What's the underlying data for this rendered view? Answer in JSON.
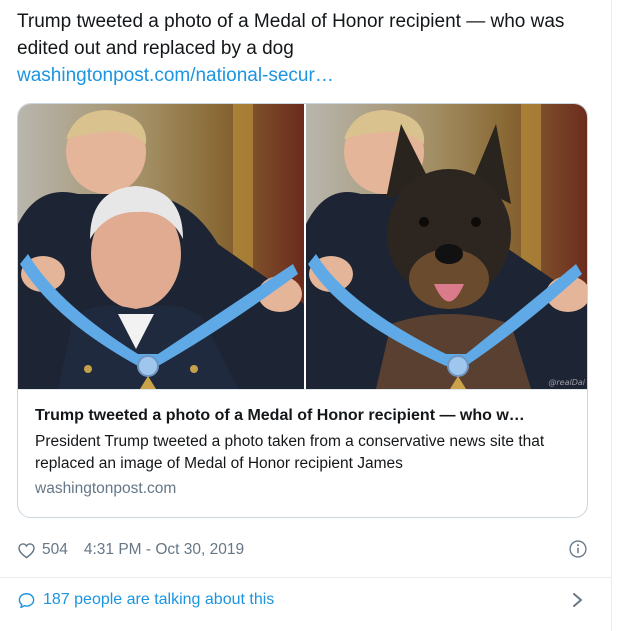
{
  "tweet": {
    "text": "Trump tweeted a photo of a Medal of Honor recipient — who was edited out and replaced by a dog",
    "link_text": "washingtonpost.com/national-secur…"
  },
  "card": {
    "title": "Trump tweeted a photo of a Medal of Honor recipient — who w…",
    "description": "President Trump tweeted a photo taken from a conservative news site that replaced an image of Medal of Honor recipient James",
    "domain": "washingtonpost.com",
    "watermark": "@realDai",
    "left_image": "medal-ceremony-photo",
    "right_image": "edited-dog-photo"
  },
  "meta": {
    "likes": "504",
    "timestamp": "4:31 PM - Oct 30, 2019",
    "like_icon": "heart-outline-icon",
    "info_icon": "info-circle-icon"
  },
  "conversation": {
    "label": "187 people are talking about this",
    "icon": "speech-bubble-icon",
    "chevron_icon": "chevron-right-icon"
  },
  "colors": {
    "link": "#1b95e0",
    "secondary_text": "#657786",
    "border": "#ccd6dd",
    "text": "#14171a"
  }
}
